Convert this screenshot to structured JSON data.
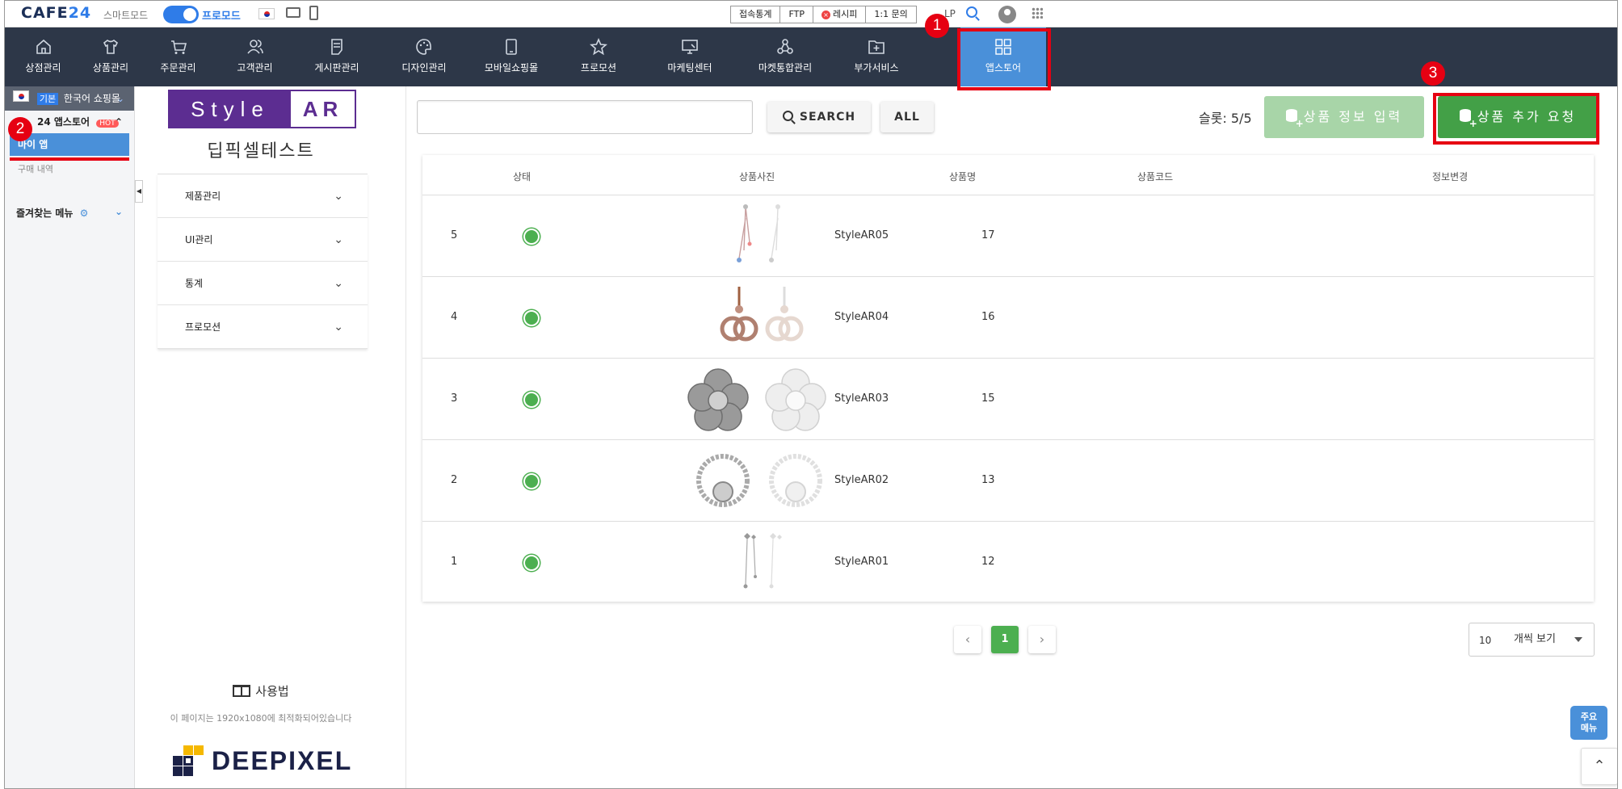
{
  "topbar": {
    "logo_main": "CAFE",
    "logo_num": "24",
    "smart_mode": "스마트모드",
    "pro_mode": "프로모드",
    "buttons": [
      "접속통계",
      "FTP",
      "레시피",
      "1:1 문의"
    ],
    "help": "LP"
  },
  "nav": [
    {
      "label": "상점관리",
      "icon": "home-icon"
    },
    {
      "label": "상품관리",
      "icon": "shirt-icon"
    },
    {
      "label": "주문관리",
      "icon": "cart-icon"
    },
    {
      "label": "고객관리",
      "icon": "users-icon"
    },
    {
      "label": "게시판관리",
      "icon": "board-icon"
    },
    {
      "label": "디자인관리",
      "icon": "palette-icon"
    },
    {
      "label": "모바일쇼핑몰",
      "icon": "mobile-icon"
    },
    {
      "label": "프로모션",
      "icon": "star-icon"
    },
    {
      "label": "마케팅센터",
      "icon": "monitor-icon"
    },
    {
      "label": "마켓통합관리",
      "icon": "network-icon"
    },
    {
      "label": "부가서비스",
      "icon": "folder-plus-icon"
    },
    {
      "label": "앱스토어",
      "icon": "grid-icon",
      "active": true
    }
  ],
  "left_sidebar": {
    "mall_tag": "기본",
    "mall_name": "한국어 쇼핑몰",
    "appstore": "24 앱스토어",
    "hot": "HOT",
    "my_app": "마이 앱",
    "purchase_history": "구매 내역",
    "favorites": "즐겨찾는 메뉴"
  },
  "app_sidebar": {
    "brand_left": "Style",
    "brand_right": "AR",
    "test_name": "딥픽셀테스트",
    "menu": [
      "제품관리",
      "UI관리",
      "통계",
      "프로모션"
    ],
    "manual": "사용법",
    "optimized_note": "이 페이지는 1920x1080에 최적화되어있습니다",
    "company_logo": "DEEPIXEL"
  },
  "toolbar": {
    "search_placeholder": "",
    "search_label": "SEARCH",
    "all_label": "ALL",
    "slots": "슬롯: 5/5",
    "info_button": "상품 정보 입력",
    "add_button": "상품 추가 요청"
  },
  "table": {
    "headers": [
      "상태",
      "상품사진",
      "상품명",
      "상품코드",
      "정보변경"
    ],
    "rows": [
      {
        "no": "5",
        "status": "active",
        "name": "StyleAR05",
        "code": "17",
        "image": "dangle-earring"
      },
      {
        "no": "4",
        "status": "active",
        "name": "StyleAR04",
        "code": "16",
        "image": "logo-earring"
      },
      {
        "no": "3",
        "status": "active",
        "name": "StyleAR03",
        "code": "15",
        "image": "flower-earring"
      },
      {
        "no": "2",
        "status": "active",
        "name": "StyleAR02",
        "code": "13",
        "image": "ring-earring"
      },
      {
        "no": "1",
        "status": "active",
        "name": "StyleAR01",
        "code": "12",
        "image": "star-drop-earring"
      }
    ]
  },
  "pagination": {
    "current": "1",
    "prev": "‹",
    "next": "›"
  },
  "per_page": {
    "value": "10",
    "label": "개씩 보기"
  },
  "quick_menu": {
    "line1": "주요",
    "line2": "메뉴"
  },
  "scroll_top": "⌃",
  "annotations": [
    "1",
    "2",
    "3"
  ],
  "colors": {
    "nav_bg": "#2d3748",
    "active": "#4a90d9",
    "green": "#43a047",
    "highlight": "#e60012"
  }
}
